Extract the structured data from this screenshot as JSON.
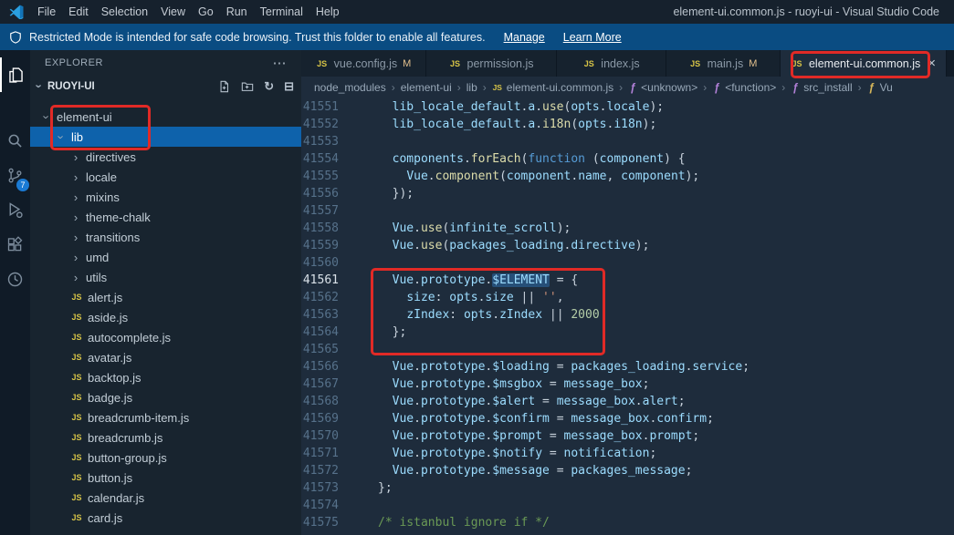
{
  "title_bar": {
    "menus": [
      "File",
      "Edit",
      "Selection",
      "View",
      "Go",
      "Run",
      "Terminal",
      "Help"
    ],
    "title": "element-ui.common.js - ruoyi-ui - Visual Studio Code"
  },
  "banner": {
    "text": "Restricted Mode is intended for safe code browsing. Trust this folder to enable all features.",
    "manage_label": "Manage",
    "learn_label": "Learn More"
  },
  "activity_bar": {
    "scm_badge": "7"
  },
  "sidebar": {
    "header": "EXPLORER",
    "section": "RUOYI-UI",
    "tree": [
      {
        "label": "element-ui",
        "type": "folder",
        "expanded": true,
        "indent": 0
      },
      {
        "label": "lib",
        "type": "folder",
        "expanded": true,
        "indent": 1,
        "selected": true
      },
      {
        "label": "directives",
        "type": "folder",
        "indent": 2
      },
      {
        "label": "locale",
        "type": "folder",
        "indent": 2
      },
      {
        "label": "mixins",
        "type": "folder",
        "indent": 2
      },
      {
        "label": "theme-chalk",
        "type": "folder",
        "indent": 2
      },
      {
        "label": "transitions",
        "type": "folder",
        "indent": 2
      },
      {
        "label": "umd",
        "type": "folder",
        "indent": 2
      },
      {
        "label": "utils",
        "type": "folder",
        "indent": 2
      },
      {
        "label": "alert.js",
        "type": "js",
        "indent": 2
      },
      {
        "label": "aside.js",
        "type": "js",
        "indent": 2
      },
      {
        "label": "autocomplete.js",
        "type": "js",
        "indent": 2
      },
      {
        "label": "avatar.js",
        "type": "js",
        "indent": 2
      },
      {
        "label": "backtop.js",
        "type": "js",
        "indent": 2
      },
      {
        "label": "badge.js",
        "type": "js",
        "indent": 2
      },
      {
        "label": "breadcrumb-item.js",
        "type": "js",
        "indent": 2
      },
      {
        "label": "breadcrumb.js",
        "type": "js",
        "indent": 2
      },
      {
        "label": "button-group.js",
        "type": "js",
        "indent": 2
      },
      {
        "label": "button.js",
        "type": "js",
        "indent": 2
      },
      {
        "label": "calendar.js",
        "type": "js",
        "indent": 2
      },
      {
        "label": "card.js",
        "type": "js",
        "indent": 2
      }
    ]
  },
  "tabs": [
    {
      "label": "vue.config.js",
      "badge": "M"
    },
    {
      "label": "permission.js"
    },
    {
      "label": "index.js"
    },
    {
      "label": "main.js",
      "badge": "M"
    },
    {
      "label": "element-ui.common.js",
      "active": true
    }
  ],
  "breadcrumb": [
    {
      "label": "node_modules"
    },
    {
      "label": "element-ui"
    },
    {
      "label": "lib"
    },
    {
      "label": "element-ui.common.js",
      "icon": "js"
    },
    {
      "label": "<unknown>",
      "icon": "sym"
    },
    {
      "label": "<function>",
      "icon": "sym"
    },
    {
      "label": "src_install",
      "icon": "sym"
    },
    {
      "label": "Vu",
      "icon": "symy"
    }
  ],
  "editor": {
    "lines": [
      {
        "n": "41551",
        "i": 2,
        "t": [
          [
            "v",
            "lib_locale_default"
          ],
          [
            "p",
            "."
          ],
          [
            "v",
            "a"
          ],
          [
            "p",
            "."
          ],
          [
            "f",
            "use"
          ],
          [
            "p",
            "("
          ],
          [
            "v",
            "opts"
          ],
          [
            "p",
            "."
          ],
          [
            "v",
            "locale"
          ],
          [
            "p",
            ");"
          ]
        ]
      },
      {
        "n": "41552",
        "i": 2,
        "t": [
          [
            "v",
            "lib_locale_default"
          ],
          [
            "p",
            "."
          ],
          [
            "v",
            "a"
          ],
          [
            "p",
            "."
          ],
          [
            "f",
            "i18n"
          ],
          [
            "p",
            "("
          ],
          [
            "v",
            "opts"
          ],
          [
            "p",
            "."
          ],
          [
            "v",
            "i18n"
          ],
          [
            "p",
            ");"
          ]
        ]
      },
      {
        "n": "41553",
        "i": 0,
        "t": []
      },
      {
        "n": "41554",
        "i": 2,
        "t": [
          [
            "v",
            "components"
          ],
          [
            "p",
            "."
          ],
          [
            "f",
            "forEach"
          ],
          [
            "p",
            "("
          ],
          [
            "k",
            "function"
          ],
          [
            "p",
            " ("
          ],
          [
            "v",
            "component"
          ],
          [
            "p",
            ") {"
          ]
        ]
      },
      {
        "n": "41555",
        "i": 4,
        "t": [
          [
            "v",
            "Vue"
          ],
          [
            "p",
            "."
          ],
          [
            "f",
            "component"
          ],
          [
            "p",
            "("
          ],
          [
            "v",
            "component"
          ],
          [
            "p",
            "."
          ],
          [
            "v",
            "name"
          ],
          [
            "p",
            ", "
          ],
          [
            "v",
            "component"
          ],
          [
            "p",
            ");"
          ]
        ]
      },
      {
        "n": "41556",
        "i": 2,
        "t": [
          [
            "p",
            "});"
          ]
        ]
      },
      {
        "n": "41557",
        "i": 0,
        "t": []
      },
      {
        "n": "41558",
        "i": 2,
        "t": [
          [
            "v",
            "Vue"
          ],
          [
            "p",
            "."
          ],
          [
            "f",
            "use"
          ],
          [
            "p",
            "("
          ],
          [
            "v",
            "infinite_scroll"
          ],
          [
            "p",
            ");"
          ]
        ]
      },
      {
        "n": "41559",
        "i": 2,
        "t": [
          [
            "v",
            "Vue"
          ],
          [
            "p",
            "."
          ],
          [
            "f",
            "use"
          ],
          [
            "p",
            "("
          ],
          [
            "v",
            "packages_loading"
          ],
          [
            "p",
            "."
          ],
          [
            "v",
            "directive"
          ],
          [
            "p",
            ");"
          ]
        ]
      },
      {
        "n": "41560",
        "i": 0,
        "t": []
      },
      {
        "n": "41561",
        "i": 2,
        "active": true,
        "t": [
          [
            "v",
            "Vue"
          ],
          [
            "p",
            "."
          ],
          [
            "v",
            "prototype"
          ],
          [
            "p",
            "."
          ],
          [
            "hl",
            "$ELEMENT"
          ],
          [
            "p",
            " = {"
          ]
        ]
      },
      {
        "n": "41562",
        "i": 4,
        "t": [
          [
            "v",
            "size"
          ],
          [
            "p",
            ": "
          ],
          [
            "v",
            "opts"
          ],
          [
            "p",
            "."
          ],
          [
            "v",
            "size"
          ],
          [
            "p",
            " || "
          ],
          [
            "s",
            "''"
          ],
          [
            "p",
            ","
          ]
        ]
      },
      {
        "n": "41563",
        "i": 4,
        "t": [
          [
            "v",
            "zIndex"
          ],
          [
            "p",
            ": "
          ],
          [
            "v",
            "opts"
          ],
          [
            "p",
            "."
          ],
          [
            "v",
            "zIndex"
          ],
          [
            "p",
            " || "
          ],
          [
            "n",
            "2000"
          ]
        ]
      },
      {
        "n": "41564",
        "i": 2,
        "t": [
          [
            "p",
            "};"
          ]
        ]
      },
      {
        "n": "41565",
        "i": 0,
        "t": []
      },
      {
        "n": "41566",
        "i": 2,
        "t": [
          [
            "v",
            "Vue"
          ],
          [
            "p",
            "."
          ],
          [
            "v",
            "prototype"
          ],
          [
            "p",
            "."
          ],
          [
            "v",
            "$loading"
          ],
          [
            "p",
            " = "
          ],
          [
            "v",
            "packages_loading"
          ],
          [
            "p",
            "."
          ],
          [
            "v",
            "service"
          ],
          [
            "p",
            ";"
          ]
        ]
      },
      {
        "n": "41567",
        "i": 2,
        "t": [
          [
            "v",
            "Vue"
          ],
          [
            "p",
            "."
          ],
          [
            "v",
            "prototype"
          ],
          [
            "p",
            "."
          ],
          [
            "v",
            "$msgbox"
          ],
          [
            "p",
            " = "
          ],
          [
            "v",
            "message_box"
          ],
          [
            "p",
            ";"
          ]
        ]
      },
      {
        "n": "41568",
        "i": 2,
        "t": [
          [
            "v",
            "Vue"
          ],
          [
            "p",
            "."
          ],
          [
            "v",
            "prototype"
          ],
          [
            "p",
            "."
          ],
          [
            "v",
            "$alert"
          ],
          [
            "p",
            " = "
          ],
          [
            "v",
            "message_box"
          ],
          [
            "p",
            "."
          ],
          [
            "v",
            "alert"
          ],
          [
            "p",
            ";"
          ]
        ]
      },
      {
        "n": "41569",
        "i": 2,
        "t": [
          [
            "v",
            "Vue"
          ],
          [
            "p",
            "."
          ],
          [
            "v",
            "prototype"
          ],
          [
            "p",
            "."
          ],
          [
            "v",
            "$confirm"
          ],
          [
            "p",
            " = "
          ],
          [
            "v",
            "message_box"
          ],
          [
            "p",
            "."
          ],
          [
            "v",
            "confirm"
          ],
          [
            "p",
            ";"
          ]
        ]
      },
      {
        "n": "41570",
        "i": 2,
        "t": [
          [
            "v",
            "Vue"
          ],
          [
            "p",
            "."
          ],
          [
            "v",
            "prototype"
          ],
          [
            "p",
            "."
          ],
          [
            "v",
            "$prompt"
          ],
          [
            "p",
            " = "
          ],
          [
            "v",
            "message_box"
          ],
          [
            "p",
            "."
          ],
          [
            "v",
            "prompt"
          ],
          [
            "p",
            ";"
          ]
        ]
      },
      {
        "n": "41571",
        "i": 2,
        "t": [
          [
            "v",
            "Vue"
          ],
          [
            "p",
            "."
          ],
          [
            "v",
            "prototype"
          ],
          [
            "p",
            "."
          ],
          [
            "v",
            "$notify"
          ],
          [
            "p",
            " = "
          ],
          [
            "v",
            "notification"
          ],
          [
            "p",
            ";"
          ]
        ]
      },
      {
        "n": "41572",
        "i": 2,
        "t": [
          [
            "v",
            "Vue"
          ],
          [
            "p",
            "."
          ],
          [
            "v",
            "prototype"
          ],
          [
            "p",
            "."
          ],
          [
            "v",
            "$message"
          ],
          [
            "p",
            " = "
          ],
          [
            "v",
            "packages_message"
          ],
          [
            "p",
            ";"
          ]
        ]
      },
      {
        "n": "41573",
        "i": 0,
        "t": [
          [
            "p",
            "};"
          ]
        ]
      },
      {
        "n": "41574",
        "i": 0,
        "t": []
      },
      {
        "n": "41575",
        "i": 0,
        "t": [
          [
            "c",
            "/* istanbul ignore if */"
          ]
        ]
      }
    ]
  },
  "icons": {
    "more": "⋯",
    "refresh": "↻",
    "collapse_all": "⊟",
    "chevron": "›",
    "bc_sep": "›",
    "close": "×",
    "js": "JS",
    "symbol": "ƒ"
  },
  "colors": {
    "annotation_red": "#e12a26",
    "selection_blue": "#264f78",
    "tree_selection_blue": "#0e62ab",
    "js_yellow": "#d7c447",
    "modified_orange": "#e2c08d",
    "scm_badge_blue": "#1a7ad4",
    "banner_blue": "#0a4c82"
  }
}
